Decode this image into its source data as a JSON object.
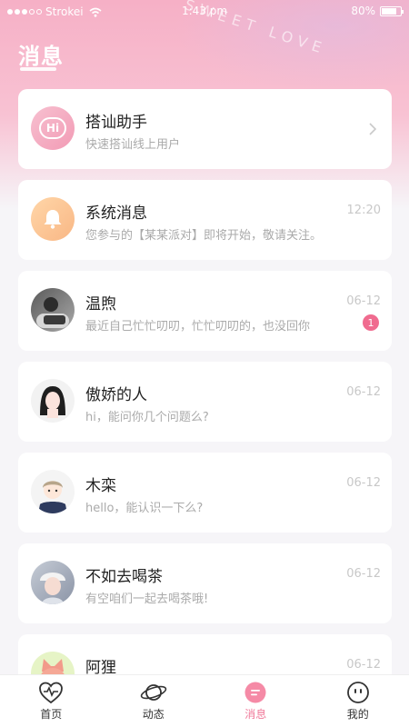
{
  "status_bar": {
    "carrier": "Strokei",
    "time": "1:43 pm",
    "battery": "80%"
  },
  "header": {
    "title": "消息",
    "decoration_text": "SWEET LOVE"
  },
  "items": [
    {
      "name": "搭讪助手",
      "message": "快速搭讪线上用户",
      "time": "",
      "avatar_icon": "hi-icon"
    },
    {
      "name": "系统消息",
      "message": "您参与的【某某派对】即将开始，敬请关注。",
      "time": "12:20",
      "avatar_icon": "bell-icon"
    },
    {
      "name": "温煦",
      "message": "最近自己忙忙叨叨，忙忙叨叨的，也没回你",
      "time": "06-12",
      "badge": "1"
    },
    {
      "name": "傲娇的人",
      "message": "hi，能问你几个问题么?",
      "time": "06-12"
    },
    {
      "name": "木栾",
      "message": "hello，能认识一下么?",
      "time": "06-12"
    },
    {
      "name": "不如去喝茶",
      "message": "有空咱们一起去喝茶哦!",
      "time": "06-12"
    },
    {
      "name": "阿狸",
      "message": "",
      "time": "06-12"
    }
  ],
  "tabs": [
    {
      "label": "首页",
      "icon": "heart-pulse-icon"
    },
    {
      "label": "动态",
      "icon": "planet-icon"
    },
    {
      "label": "消息",
      "icon": "message-icon"
    },
    {
      "label": "我的",
      "icon": "face-icon"
    }
  ],
  "active_tab": "消息",
  "colors": {
    "accent": "#f07a9a",
    "hero_pink": "#f6b0c6",
    "badge": "#f06b8f"
  }
}
